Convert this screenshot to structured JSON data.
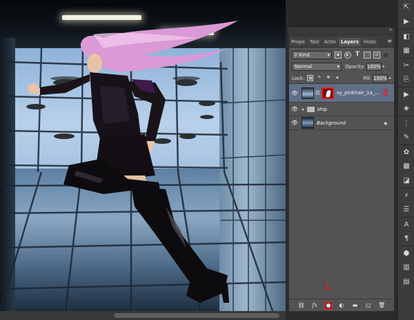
{
  "panel": {
    "tabs": [
      "Prope",
      "Tool",
      "Actio",
      "Layers",
      "Histo"
    ],
    "active_tab": "Layers",
    "menu_icon": "panel-menu-icon",
    "filter": {
      "kind_label": "Kind",
      "filter_icons": [
        "image-filter-icon",
        "adjustment-filter-icon",
        "type-filter-icon",
        "shape-filter-icon",
        "smart-object-filter-icon"
      ]
    },
    "blend_mode": "Normal",
    "opacity_label": "Opacity:",
    "opacity_value": "100%",
    "lock_label": "Lock:",
    "fill_label": "Fill:",
    "fill_value": "100%",
    "layers": [
      {
        "name": "sy_pinkhair_1a_...",
        "type": "image-with-mask",
        "selected": true,
        "annotation": "2"
      },
      {
        "name": "ship",
        "type": "group",
        "selected": false
      },
      {
        "name": "Background",
        "type": "background",
        "selected": false,
        "locked": true
      }
    ],
    "footer": {
      "annotation": "1",
      "icons": [
        "link-layers-icon",
        "fx-icon",
        "add-mask-icon",
        "adjustment-layer-icon",
        "new-group-icon",
        "new-layer-icon",
        "delete-layer-icon"
      ],
      "fx_label": "fx"
    }
  },
  "tools": [
    "history-icon",
    "actions-icon",
    "color-icon",
    "swatches-icon",
    "brushes-icon",
    "clone-source-icon",
    "play-icon",
    "layers-icon",
    "channels-icon",
    "paths-icon",
    "adjustments-icon",
    "styles-icon",
    "info-icon",
    "character-icon",
    "paragraph-icon",
    "3d-icon",
    "timeline-icon",
    "navigator-icon"
  ],
  "colors": {
    "panel_bg": "#535353",
    "selected_layer": "#5f6f86",
    "annotation_red": "#d6252a",
    "mask_border": "#d81f1f"
  }
}
